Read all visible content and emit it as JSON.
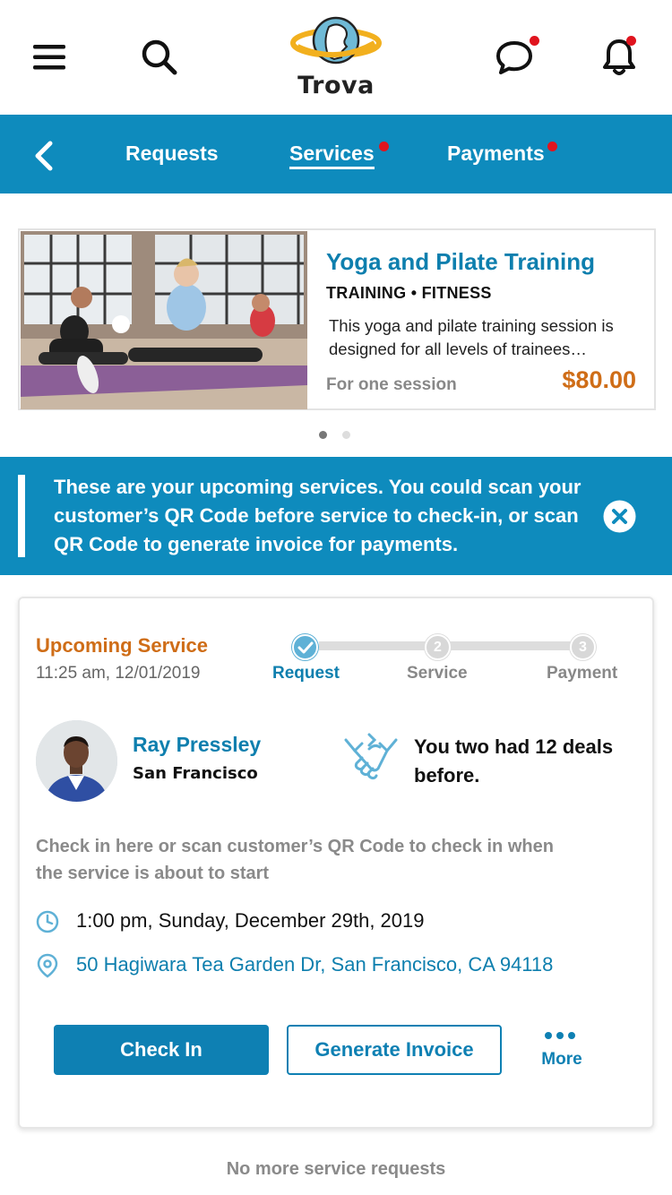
{
  "app": {
    "brand": "Trova",
    "accent": "#0e8bbd",
    "price_color": "#cf6d17"
  },
  "header": {
    "menu_icon": "hamburger-icon",
    "search_icon": "search-icon",
    "messages_icon": "chat-bubble-icon",
    "notifications_icon": "bell-icon",
    "messages_has_badge": true,
    "notifications_has_badge": true
  },
  "nav": {
    "back_icon": "chevron-left-icon",
    "tabs": [
      {
        "label": "Requests",
        "active": false,
        "badge": false
      },
      {
        "label": "Services",
        "active": true,
        "badge": true
      },
      {
        "label": "Payments",
        "active": false,
        "badge": true
      }
    ]
  },
  "service_card": {
    "title": "Yoga and Pilate Training",
    "category": "TRAINING • FITNESS",
    "description": "This yoga and pilate training session is designed for all levels of  trainees…",
    "session_label": "For one session",
    "price": "$80.00",
    "carousel_pages": 2,
    "carousel_active": 1
  },
  "banner": {
    "message": "These are your upcoming services. You could scan your customer’s QR Code before service to check-in, or scan QR Code to generate invoice for payments.",
    "close_icon": "close-circle-icon"
  },
  "upcoming": {
    "title": "Upcoming Service",
    "timestamp": "11:25 am, 12/01/2019",
    "steps": [
      {
        "number": "",
        "label": "Request",
        "done": true
      },
      {
        "number": "2",
        "label": "Service",
        "done": false
      },
      {
        "number": "3",
        "label": "Payment",
        "done": false
      }
    ],
    "customer": {
      "name": "Ray Pressley",
      "city": "San Francisco"
    },
    "deals_text": "You two had 12 deals before.",
    "hint": "Check in here or scan customer’s QR Code to check in when the service is about to start",
    "datetime": "1:00 pm, Sunday, December 29th, 2019",
    "address": "50 Hagiwara Tea Garden Dr, San Francisco, CA 94118",
    "actions": {
      "check_in": "Check In",
      "generate_invoice": "Generate Invoice",
      "more": "More"
    }
  },
  "footer": {
    "note": "No more service requests"
  }
}
